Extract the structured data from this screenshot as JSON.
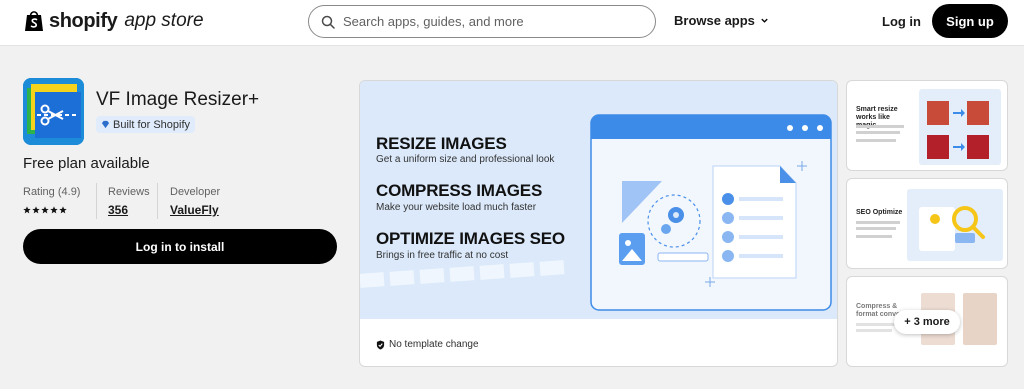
{
  "header": {
    "brand_name": "shopify",
    "brand_sub": "app store",
    "search_placeholder": "Search apps, guides, and more",
    "browse_label": "Browse apps",
    "login_label": "Log in",
    "signup_label": "Sign up"
  },
  "app": {
    "title": "VF Image Resizer+",
    "badge": "Built for Shopify",
    "pricing": "Free plan available",
    "rating_label": "Rating (4.9)",
    "rating_value": 4.9,
    "stars": 5,
    "reviews_label": "Reviews",
    "reviews_count": "356",
    "developer_label": "Developer",
    "developer_name": "ValueFly",
    "install_label": "Log in to install"
  },
  "media": {
    "features": [
      {
        "title": "RESIZE IMAGES",
        "sub": "Get a uniform size and professional look"
      },
      {
        "title": "COMPRESS IMAGES",
        "sub": "Make your website load much faster"
      },
      {
        "title": "OPTIMIZE IMAGES SEO",
        "sub": "Brings in free traffic at no cost"
      }
    ],
    "footer_note": "No template change"
  },
  "thumbnails": [
    {
      "caption": "Smart resize works like magic"
    },
    {
      "caption": "SEO Optimize"
    },
    {
      "caption": "Compress & format conver"
    }
  ],
  "more_label": "+ 3 more",
  "colors": {
    "accent_black": "#000000",
    "art_background": "#dbe9fa",
    "badge_bg": "#e0ecfb",
    "icon_blue": "#1d8cd8"
  }
}
